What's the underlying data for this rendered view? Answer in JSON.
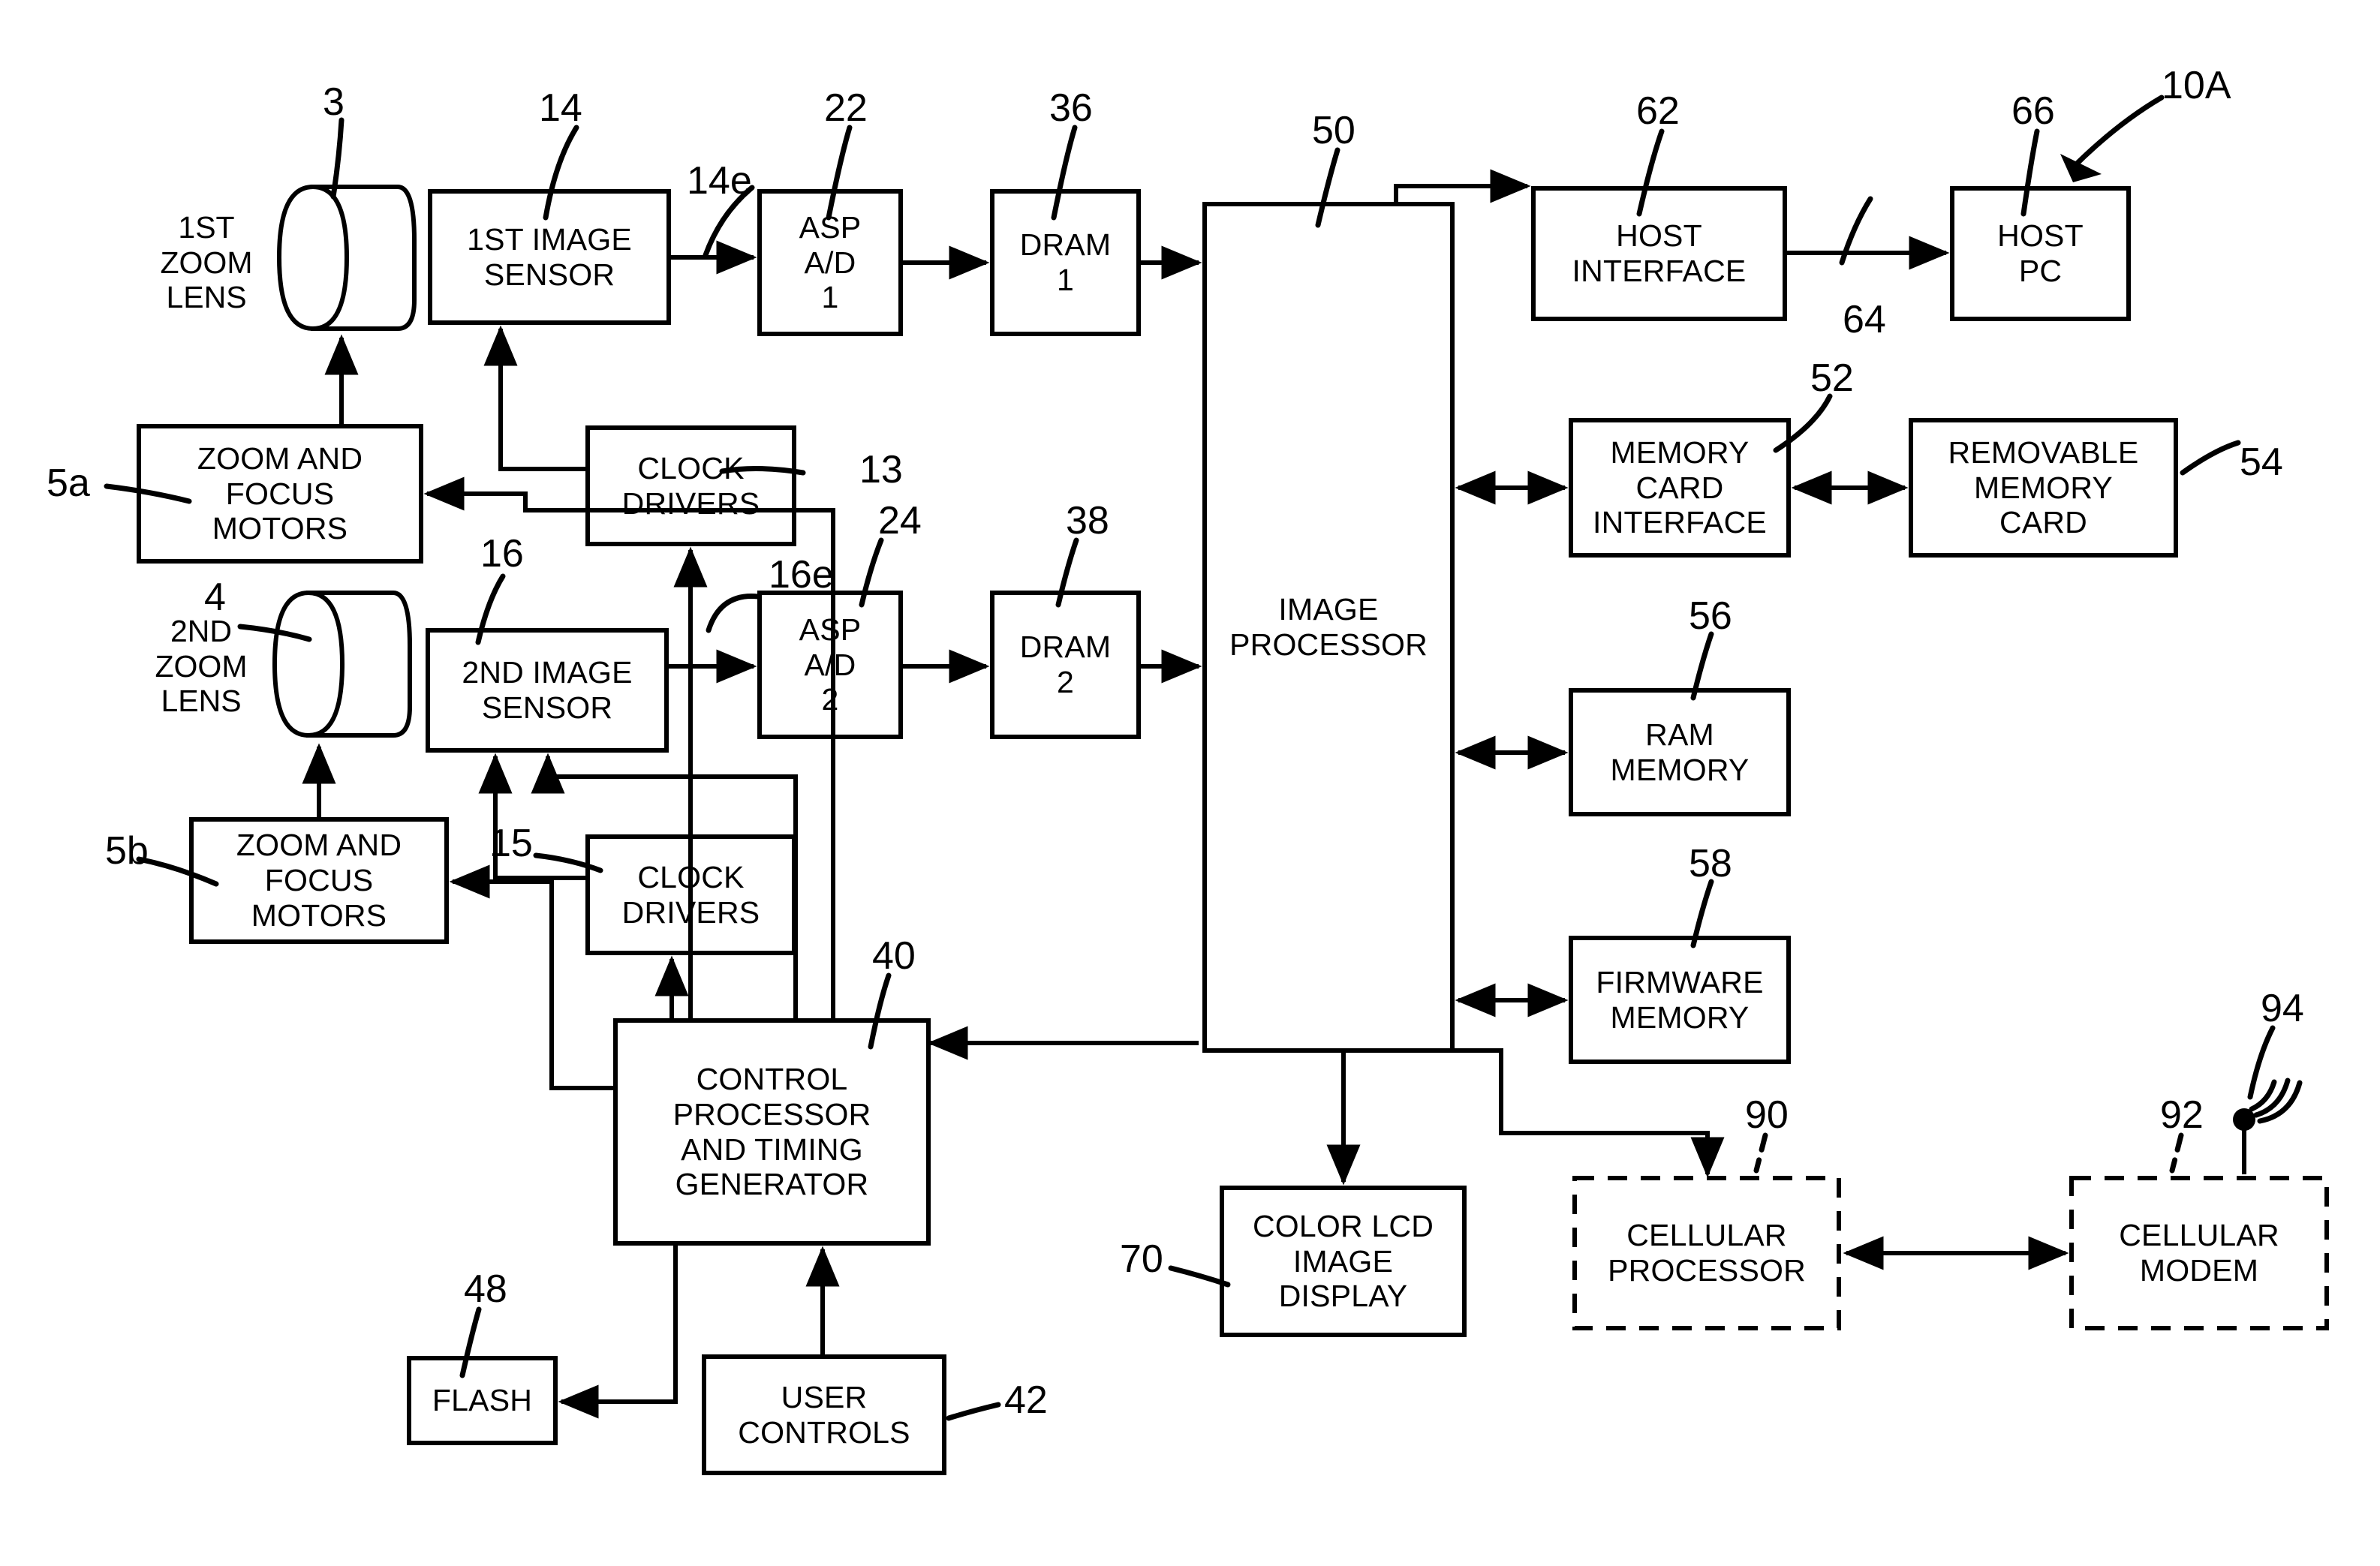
{
  "figure": {
    "title_ref": "10A",
    "blocks": [
      {
        "id": "first_zoom_lens_label",
        "label": "1ST\nZOOM\nLENS",
        "ref": "3"
      },
      {
        "id": "second_zoom_lens_label",
        "label": "2ND\nZOOM\nLENS",
        "ref": "4"
      },
      {
        "id": "first_image_sensor",
        "label": "1ST IMAGE\nSENSOR",
        "ref": "14",
        "out_ref": "14e"
      },
      {
        "id": "second_image_sensor",
        "label": "2ND IMAGE\nSENSOR",
        "ref": "16",
        "out_ref": "16e"
      },
      {
        "id": "asp_ad_1",
        "label": "ASP\nA/D\n1",
        "ref": "22"
      },
      {
        "id": "asp_ad_2",
        "label": "ASP\nA/D\n2",
        "ref": "24"
      },
      {
        "id": "dram_1",
        "label": "DRAM\n1",
        "ref": "36"
      },
      {
        "id": "dram_2",
        "label": "DRAM\n2",
        "ref": "38"
      },
      {
        "id": "image_processor",
        "label": "IMAGE\nPROCESSOR",
        "ref": "50"
      },
      {
        "id": "host_interface",
        "label": "HOST\nINTERFACE",
        "ref": "62"
      },
      {
        "id": "host_pc",
        "label": "HOST\nPC",
        "ref": "66",
        "link_ref": "64"
      },
      {
        "id": "memory_card_interface",
        "label": "MEMORY\nCARD\nINTERFACE",
        "ref": "52"
      },
      {
        "id": "removable_memory_card",
        "label": "REMOVABLE\nMEMORY\nCARD",
        "ref": "54"
      },
      {
        "id": "ram_memory",
        "label": "RAM\nMEMORY",
        "ref": "56"
      },
      {
        "id": "firmware_memory",
        "label": "FIRMWARE\nMEMORY",
        "ref": "58"
      },
      {
        "id": "zoom_focus_motors_a",
        "label": "ZOOM AND\nFOCUS\nMOTORS",
        "ref": "5a"
      },
      {
        "id": "zoom_focus_motors_b",
        "label": "ZOOM AND\nFOCUS\nMOTORS",
        "ref": "5b"
      },
      {
        "id": "clock_drivers_1",
        "label": "CLOCK\nDRIVERS",
        "ref": "13"
      },
      {
        "id": "clock_drivers_2",
        "label": "CLOCK\nDRIVERS",
        "ref": "15"
      },
      {
        "id": "control_processor",
        "label": "CONTROL\nPROCESSOR\nAND TIMING\nGENERATOR",
        "ref": "40"
      },
      {
        "id": "flash",
        "label": "FLASH",
        "ref": "48"
      },
      {
        "id": "user_controls",
        "label": "USER\nCONTROLS",
        "ref": "42"
      },
      {
        "id": "color_lcd_image_display",
        "label": "COLOR LCD\nIMAGE\nDISPLAY",
        "ref": "70"
      },
      {
        "id": "cellular_processor",
        "label": "CELLULAR\nPROCESSOR",
        "ref": "90",
        "style": "dashed"
      },
      {
        "id": "cellular_modem",
        "label": "CELLULAR\nMODEM",
        "ref": "92",
        "style": "dashed"
      },
      {
        "id": "antenna",
        "label": "",
        "ref": "94"
      }
    ]
  },
  "labels": {
    "first_zoom_lens": "1ST\nZOOM\nLENS",
    "second_zoom_lens": "2ND\nZOOM\nLENS",
    "first_image_sensor": "1ST IMAGE\nSENSOR",
    "second_image_sensor": "2ND IMAGE\nSENSOR",
    "asp_ad_1": "ASP\nA/D\n1",
    "asp_ad_2": "ASP\nA/D\n2",
    "dram_1": "DRAM\n1",
    "dram_2": "DRAM\n2",
    "image_processor": "IMAGE\nPROCESSOR",
    "host_interface": "HOST\nINTERFACE",
    "host_pc": "HOST\nPC",
    "memory_card_interface": "MEMORY\nCARD\nINTERFACE",
    "removable_memory_card": "REMOVABLE\nMEMORY\nCARD",
    "ram_memory": "RAM\nMEMORY",
    "firmware_memory": "FIRMWARE\nMEMORY",
    "zoom_focus_motors_a": "ZOOM AND\nFOCUS\nMOTORS",
    "zoom_focus_motors_b": "ZOOM AND\nFOCUS\nMOTORS",
    "clock_drivers_1": "CLOCK\nDRIVERS",
    "clock_drivers_2": "CLOCK\nDRIVERS",
    "control_processor": "CONTROL\nPROCESSOR\nAND TIMING\nGENERATOR",
    "flash": "FLASH",
    "user_controls": "USER\nCONTROLS",
    "color_lcd_image_display": "COLOR LCD\nIMAGE\nDISPLAY",
    "cellular_processor": "CELLULAR\nPROCESSOR",
    "cellular_modem": "CELLULAR\nMODEM"
  },
  "refs": {
    "fig": "10A",
    "lens1": "3",
    "lens2": "4",
    "motors_a": "5a",
    "motors_b": "5b",
    "clock1": "13",
    "clock2": "15",
    "sensor1": "14",
    "sensor1_out": "14e",
    "sensor2": "16",
    "sensor2_out": "16e",
    "asp1": "22",
    "asp2": "24",
    "dram1": "36",
    "dram2": "38",
    "control": "40",
    "user_controls": "42",
    "flash": "48",
    "image_processor": "50",
    "memory_card_interface": "52",
    "removable_memory_card": "54",
    "ram": "56",
    "firmware": "58",
    "host_interface": "62",
    "host_link": "64",
    "host_pc": "66",
    "lcd": "70",
    "cell_proc": "90",
    "cell_modem": "92",
    "antenna": "94"
  },
  "colors": {
    "ink": "#000000",
    "paper": "#ffffff"
  }
}
